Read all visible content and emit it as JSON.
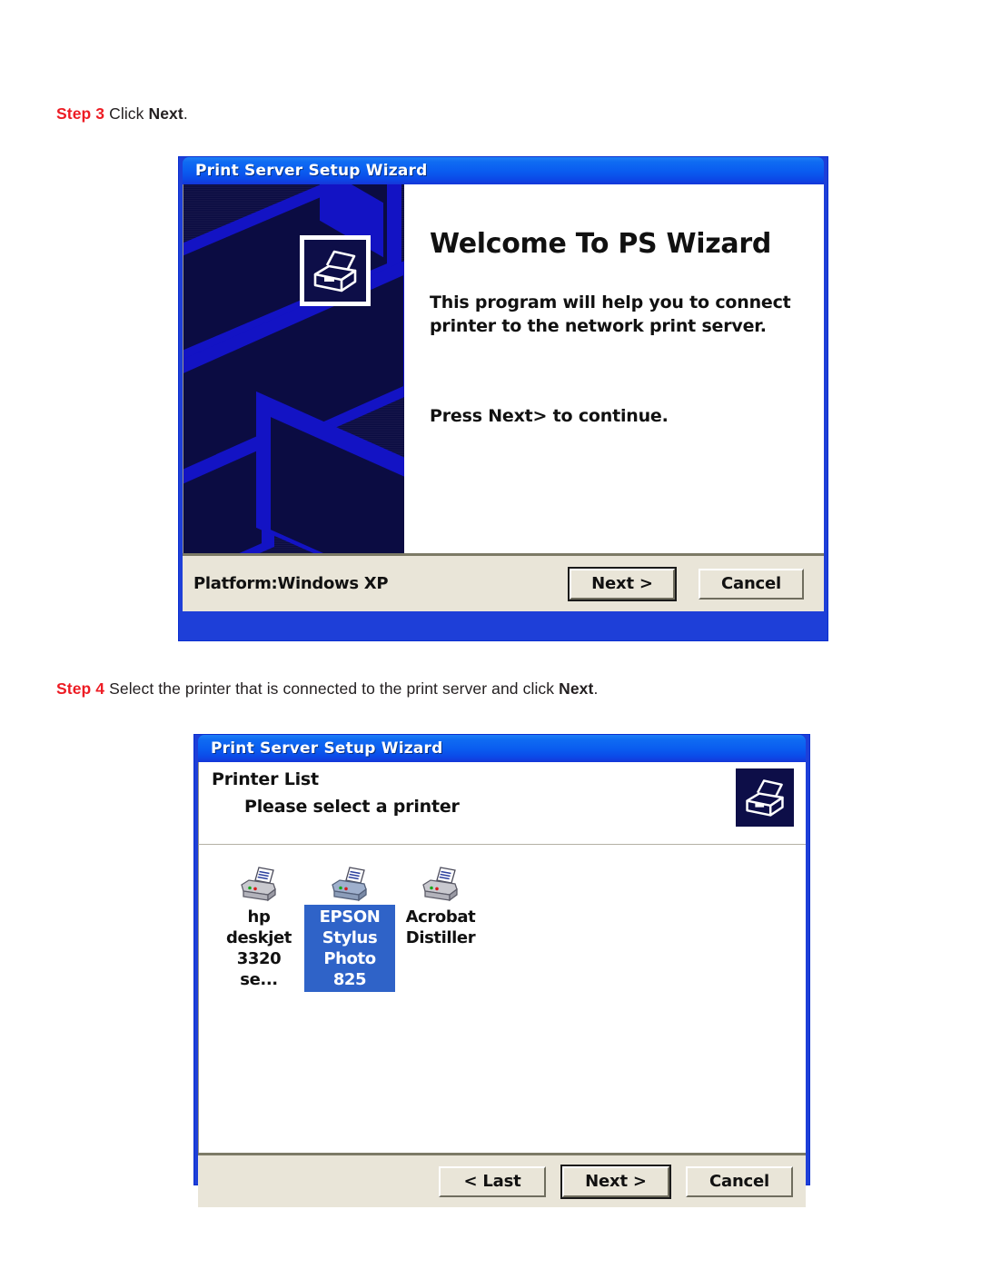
{
  "steps": {
    "step3": {
      "label": "Step 3",
      "text_before": " Click ",
      "bold": "Next",
      "text_after": "."
    },
    "step4": {
      "label": "Step 4",
      "text_before": " Select the printer that is connected to the print server and click ",
      "bold": "Next",
      "text_after": "."
    }
  },
  "dialog_welcome": {
    "title": "Print Server Setup Wizard",
    "heading": "Welcome To PS Wizard",
    "paragraph": "This program will help you to connect printer to the network print server.",
    "press_text": "Press Next> to continue.",
    "platform": "Platform:Windows XP",
    "buttons": {
      "next": "Next >",
      "cancel": "Cancel"
    },
    "icon": "printer-icon"
  },
  "dialog_printer_list": {
    "title": "Print Server Setup Wizard",
    "heading": "Printer  List",
    "subheading": "Please select a printer",
    "icon": "printer-icon",
    "printers": [
      {
        "label": "hp deskjet\n3320 se...",
        "selected": false,
        "icon": "printer-icon"
      },
      {
        "label": "EPSON\nStylus\nPhoto 825",
        "selected": true,
        "icon": "printer-icon"
      },
      {
        "label": "Acrobat\nDistiller",
        "selected": false,
        "icon": "printer-icon"
      }
    ],
    "buttons": {
      "last": "< Last",
      "next": "Next >",
      "cancel": "Cancel"
    }
  },
  "colors": {
    "accent_red": "#ed1c24",
    "titlebar_blue": "#0a5cf0",
    "frame_blue": "#1e3fd8",
    "selection_blue": "#2f63c8",
    "dialog_beige": "#e9e5d8",
    "art_navy": "#0b0c42",
    "art_blue": "#1313c4"
  }
}
